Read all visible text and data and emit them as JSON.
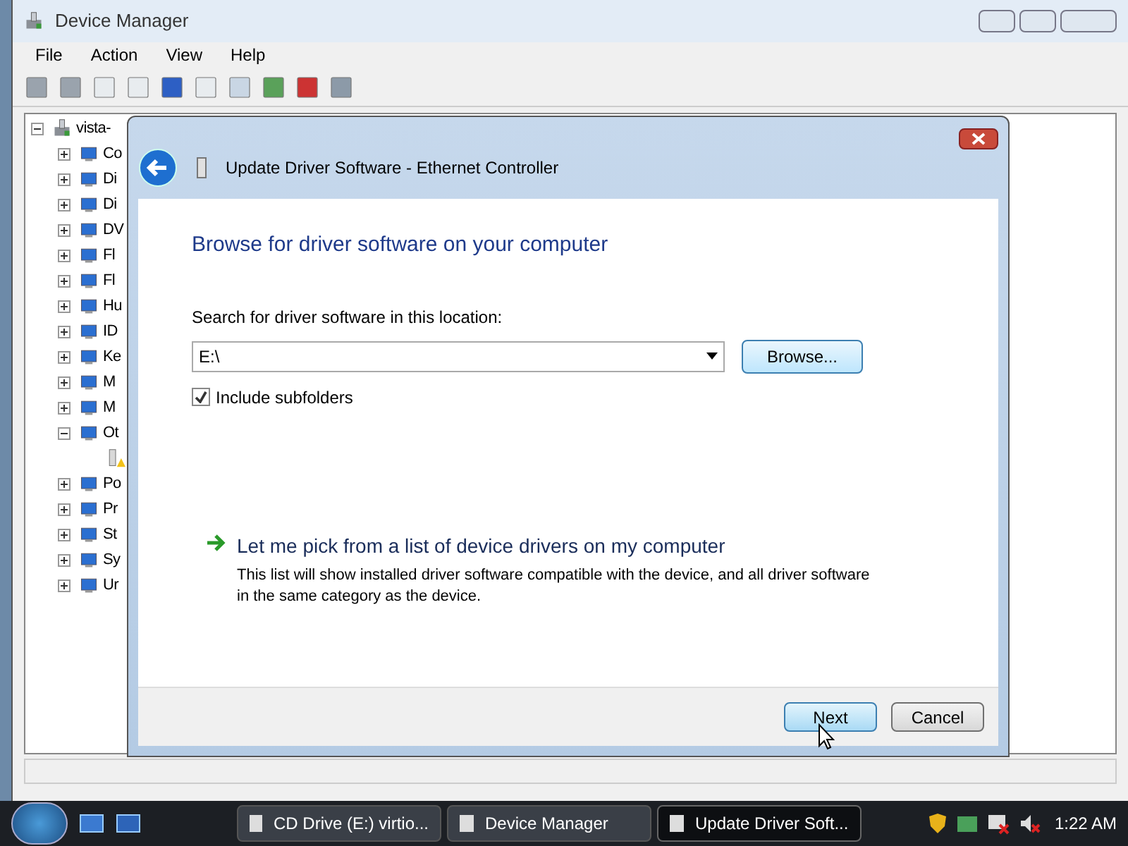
{
  "window": {
    "title": "Device Manager"
  },
  "menu": [
    "File",
    "Action",
    "View",
    "Help"
  ],
  "tree": [
    {
      "label": "vista-",
      "kind": "computer",
      "expanded": true,
      "children": [
        {
          "label": "Co",
          "kind": "category",
          "expanded": false
        },
        {
          "label": "Di",
          "kind": "category",
          "expanded": false
        },
        {
          "label": "Di",
          "kind": "category",
          "expanded": false
        },
        {
          "label": "DV",
          "kind": "category",
          "expanded": false
        },
        {
          "label": "Fl",
          "kind": "category",
          "expanded": false
        },
        {
          "label": "Fl",
          "kind": "category",
          "expanded": false
        },
        {
          "label": "Hu",
          "kind": "category",
          "expanded": false
        },
        {
          "label": "ID",
          "kind": "category",
          "expanded": false
        },
        {
          "label": "Ke",
          "kind": "category",
          "expanded": false
        },
        {
          "label": "M",
          "kind": "category",
          "expanded": false
        },
        {
          "label": "M",
          "kind": "category",
          "expanded": false
        },
        {
          "label": "Ot",
          "kind": "category",
          "expanded": true,
          "children": [
            {
              "kind": "device"
            }
          ]
        },
        {
          "label": "Po",
          "kind": "category",
          "expanded": false
        },
        {
          "label": "Pr",
          "kind": "category",
          "expanded": false
        },
        {
          "label": "St",
          "kind": "category",
          "expanded": false
        },
        {
          "label": "Sy",
          "kind": "category",
          "expanded": false
        },
        {
          "label": "Ur",
          "kind": "category",
          "expanded": false
        }
      ]
    }
  ],
  "dialog": {
    "title": "Update Driver Software - Ethernet Controller",
    "heading": "Browse for driver software on your computer",
    "location_label": "Search for driver software in this location:",
    "location_value": "E:\\",
    "browse_button": "Browse...",
    "include_subfolders": {
      "label": "Include subfolders",
      "checked": true
    },
    "pick_link": "Let me pick from a list of device drivers on my computer",
    "pick_description": "This list will show installed driver software compatible with the device, and all driver software in the same category as the device.",
    "buttons": [
      {
        "label": "Next",
        "default": true
      },
      {
        "label": "Cancel",
        "default": false
      }
    ]
  },
  "taskbar": {
    "items": [
      {
        "label": "CD Drive (E:) virtio...",
        "selected": false
      },
      {
        "label": "Device Manager",
        "selected": false
      },
      {
        "label": "Update Driver Soft...",
        "selected": true
      }
    ],
    "clock": "1:22 AM"
  }
}
